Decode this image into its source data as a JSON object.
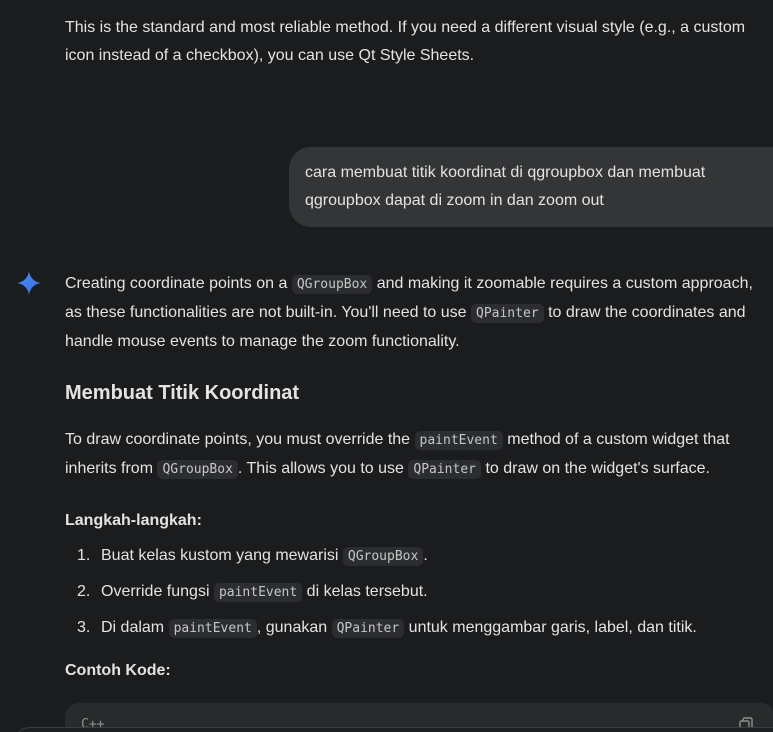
{
  "previous_answer": {
    "text": "This is the standard and most reliable method. If you need a different visual style (e.g., a custom icon instead of a checkbox), you can use Qt Style Sheets."
  },
  "user_message": {
    "text": "cara membuat titik koordinat di qgroupbox dan membuat qgroupbox dapat di zoom in dan zoom out"
  },
  "response": {
    "icon": "gemini-spark-icon",
    "intro": {
      "t1": "Creating coordinate points on a ",
      "c1": "QGroupBox",
      "t2": " and making it zoomable requires a custom approach, as these functionalities are not built-in. You'll need to use ",
      "c2": "QPainter",
      "t3": " to draw the coordinates and handle mouse events to manage the zoom functionality."
    },
    "heading": "Membuat Titik Koordinat",
    "para": {
      "t1": "To draw coordinate points, you must override the ",
      "c1": "paintEvent",
      "t2": " method of a custom widget that inherits from ",
      "c2": "QGroupBox",
      "t3": ". This allows you to use ",
      "c3": "QPainter",
      "t4": " to draw on the widget's surface."
    },
    "steps_heading": "Langkah-langkah:",
    "steps": [
      {
        "num": "1.",
        "t1": "Buat kelas kustom yang mewarisi ",
        "c1": "QGroupBox",
        "t2": "."
      },
      {
        "num": "2.",
        "t1": "Override fungsi ",
        "c1": "paintEvent",
        "t2": " di kelas tersebut."
      },
      {
        "num": "3.",
        "t1": "Di dalam ",
        "c1": "paintEvent",
        "t2": ", gunakan ",
        "c2": "QPainter",
        "t3": " untuk menggambar garis, label, dan titik."
      }
    ],
    "code_heading": "Contoh Kode:",
    "code_block": {
      "language": "C++",
      "copy_icon": "copy-icon"
    }
  },
  "colors": {
    "background": "#1b1c1d",
    "user_bubble": "#333537",
    "code_bg": "#2c2d30",
    "spark": "#4a8cf7"
  }
}
